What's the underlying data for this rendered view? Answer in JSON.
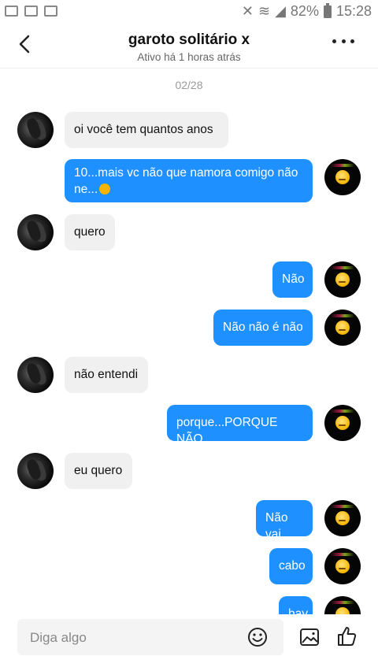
{
  "status": {
    "battery": "82%",
    "time": "15:28"
  },
  "header": {
    "title": "garoto solitário x",
    "subtitle": "Ativo há 1 horas atrás"
  },
  "chat": {
    "date": "02/28",
    "messages": [
      {
        "from": "them",
        "text": "oi você tem quantos anos"
      },
      {
        "from": "me",
        "text": "10...mais vc não que namora comigo não ne...",
        "emoji": "smiley-icon"
      },
      {
        "from": "them",
        "text": "quero"
      },
      {
        "from": "me",
        "text": "Não"
      },
      {
        "from": "me",
        "text": "Não não é não"
      },
      {
        "from": "them",
        "text": "não entendi"
      },
      {
        "from": "me",
        "text": "porque...PORQUE NÃO"
      },
      {
        "from": "them",
        "text": "eu quero"
      },
      {
        "from": "me",
        "text": "Não vai"
      },
      {
        "from": "me",
        "text": "cabo"
      },
      {
        "from": "me",
        "text": "bay"
      }
    ]
  },
  "composer": {
    "placeholder": "Diga algo"
  },
  "colors": {
    "my_bubble": "#1e90ff",
    "their_bubble": "#f1f0f0"
  }
}
